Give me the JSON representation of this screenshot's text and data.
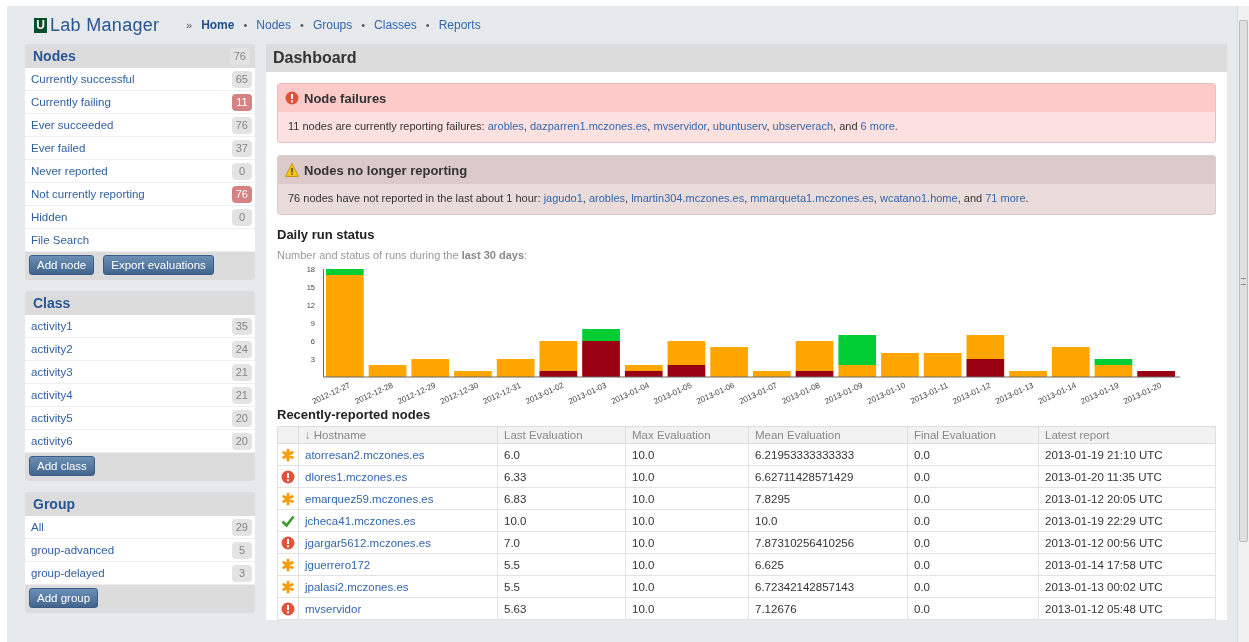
{
  "header": {
    "logo_mark": "U",
    "title": "Lab Manager",
    "nav_lead": "»",
    "separator": "•",
    "nav": [
      {
        "label": "Home",
        "selected": true
      },
      {
        "label": "Nodes",
        "selected": false
      },
      {
        "label": "Groups",
        "selected": false
      },
      {
        "label": "Classes",
        "selected": false
      },
      {
        "label": "Reports",
        "selected": false
      }
    ]
  },
  "sidebar": [
    {
      "title": "Nodes",
      "count": "76",
      "items": [
        {
          "label": "Currently successful",
          "count": "65",
          "alert": false
        },
        {
          "label": "Currently failing",
          "count": "11",
          "alert": true
        },
        {
          "label": "Ever succeeded",
          "count": "76",
          "alert": false
        },
        {
          "label": "Ever failed",
          "count": "37",
          "alert": false
        },
        {
          "label": "Never reported",
          "count": "0",
          "alert": false
        },
        {
          "label": "Not currently reporting",
          "count": "76",
          "alert": true
        },
        {
          "label": "Hidden",
          "count": "0",
          "alert": false
        },
        {
          "label": "File Search"
        }
      ],
      "buttons": [
        "Add node",
        "Export evaluations"
      ]
    },
    {
      "title": "Class",
      "items": [
        {
          "label": "activity1",
          "count": "35",
          "alert": false
        },
        {
          "label": "activity2",
          "count": "24",
          "alert": false
        },
        {
          "label": "activity3",
          "count": "21",
          "alert": false
        },
        {
          "label": "activity4",
          "count": "21",
          "alert": false
        },
        {
          "label": "activity5",
          "count": "20",
          "alert": false
        },
        {
          "label": "activity6",
          "count": "20",
          "alert": false
        }
      ],
      "buttons": [
        "Add class"
      ]
    },
    {
      "title": "Group",
      "items": [
        {
          "label": "All",
          "count": "29",
          "alert": false
        },
        {
          "label": "group-advanced",
          "count": "5",
          "alert": false
        },
        {
          "label": "group-delayed",
          "count": "3",
          "alert": false
        }
      ],
      "buttons": [
        "Add group"
      ]
    }
  ],
  "main": {
    "title": "Dashboard",
    "alerts": [
      {
        "kind": "error",
        "title": "Node failures",
        "body": [
          {
            "text": "11 nodes are currently reporting failures: "
          },
          {
            "link": "arobles"
          },
          {
            "text": ", "
          },
          {
            "link": "dazparren1.mczones.es"
          },
          {
            "text": ", "
          },
          {
            "link": "mvservidor"
          },
          {
            "text": ", "
          },
          {
            "link": "ubuntuserv"
          },
          {
            "text": ", "
          },
          {
            "link": "ubserverach"
          },
          {
            "text": ", and "
          },
          {
            "link": "6 more"
          },
          {
            "text": "."
          }
        ]
      },
      {
        "kind": "warning",
        "title": "Nodes no longer reporting",
        "body": [
          {
            "text": "76 nodes have not reported in the last about 1 hour: "
          },
          {
            "link": "jagudo1"
          },
          {
            "text": ", "
          },
          {
            "link": "arobles"
          },
          {
            "text": ", "
          },
          {
            "link": "lmartin304.mczones.es"
          },
          {
            "text": ", "
          },
          {
            "link": "mmarqueta1.mczones.es"
          },
          {
            "text": ", "
          },
          {
            "link": "wcatano1.home"
          },
          {
            "text": ", and "
          },
          {
            "link": "71 more"
          },
          {
            "text": "."
          }
        ]
      }
    ],
    "run_status": {
      "title": "Daily run status",
      "caption": "Number and status of runs during the **last 30 days**:",
      "chart_data": {
        "type": "bar",
        "stacked": true,
        "categories": [
          "2012-12-27",
          "2012-12-28",
          "2012-12-29",
          "2012-12-30",
          "2012-12-31",
          "2013-01-02",
          "2013-01-03",
          "2013-01-04",
          "2013-01-05",
          "2013-01-06",
          "2013-01-07",
          "2013-01-08",
          "2013-01-09",
          "2013-01-10",
          "2013-01-11",
          "2013-01-12",
          "2013-01-13",
          "2013-01-14",
          "2013-01-19",
          "2013-01-20"
        ],
        "ylim": [
          0,
          18
        ],
        "yticks": [
          3,
          6,
          9,
          12,
          15,
          18
        ],
        "series": [
          {
            "color": "#990012",
            "values": [
              0,
              0,
              0,
              0,
              0,
              1,
              6,
              1,
              2,
              0,
              0,
              1,
              0,
              0,
              0,
              3,
              0,
              0,
              0,
              1
            ]
          },
          {
            "color": "#ffa500",
            "values": [
              17,
              2,
              3,
              1,
              3,
              5,
              0,
              1,
              4,
              5,
              1,
              5,
              2,
              4,
              4,
              4,
              1,
              5,
              2,
              0
            ]
          },
          {
            "color": "#00cc33",
            "values": [
              1,
              0,
              0,
              0,
              0,
              0,
              2,
              0,
              0,
              0,
              0,
              0,
              5,
              0,
              0,
              0,
              0,
              0,
              1,
              0
            ]
          }
        ]
      }
    },
    "nodes_table": {
      "title": "Recently-reported nodes",
      "sort_mark": "↓",
      "columns": [
        "Hostname",
        "Last Evaluation",
        "Max Evaluation",
        "Mean Evaluation",
        "Final Evaluation",
        "Latest report"
      ],
      "rows": [
        {
          "kind": "changed",
          "cells": [
            "atorresan2.mczones.es",
            "6.0",
            "10.0",
            "6.21953333333333",
            "0.0",
            "2013-01-19 21:10 UTC"
          ]
        },
        {
          "kind": "failed",
          "cells": [
            "dlores1.mczones.es",
            "6.33",
            "10.0",
            "6.62711428571429",
            "0.0",
            "2013-01-20 11:35 UTC"
          ]
        },
        {
          "kind": "changed",
          "cells": [
            "emarquez59.mczones.es",
            "6.83",
            "10.0",
            "7.8295",
            "0.0",
            "2013-01-12 20:05 UTC"
          ]
        },
        {
          "kind": "success",
          "cells": [
            "jcheca41.mczones.es",
            "10.0",
            "10.0",
            "10.0",
            "0.0",
            "2013-01-19 22:29 UTC"
          ]
        },
        {
          "kind": "failed",
          "cells": [
            "jgargar5612.mczones.es",
            "7.0",
            "10.0",
            "7.87310256410256",
            "0.0",
            "2013-01-12 00:56 UTC"
          ]
        },
        {
          "kind": "changed",
          "cells": [
            "jguerrero172",
            "5.5",
            "10.0",
            "6.625",
            "0.0",
            "2013-01-14 17:58 UTC"
          ]
        },
        {
          "kind": "changed",
          "cells": [
            "jpalasi2.mczones.es",
            "5.5",
            "10.0",
            "6.72342142857143",
            "0.0",
            "2013-01-13 00:02 UTC"
          ]
        },
        {
          "kind": "failed",
          "cells": [
            "mvservidor",
            "5.63",
            "10.0",
            "7.12676",
            "0.0",
            "2013-01-12 05:48 UTC"
          ]
        }
      ]
    }
  }
}
